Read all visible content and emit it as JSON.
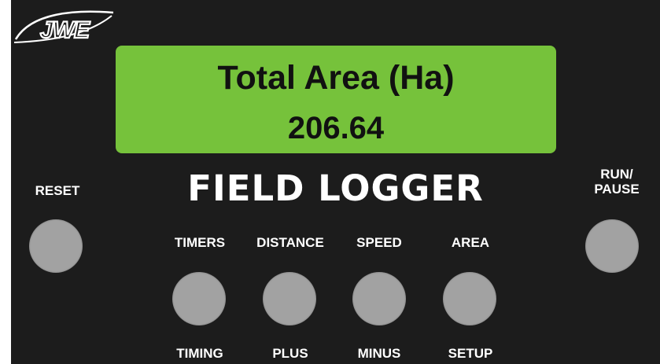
{
  "logo": {
    "text": "JWE"
  },
  "display": {
    "line1": "Total Area (Ha)",
    "line2": "206.64"
  },
  "brand": {
    "title": "FIELD LOGGER"
  },
  "buttons": {
    "reset": {
      "label": "RESET"
    },
    "run_pause": {
      "label_top": "RUN/",
      "label_bottom": "PAUSE"
    },
    "timers": {
      "top_label": "TIMERS",
      "bottom_label": "TIMING"
    },
    "distance": {
      "top_label": "DISTANCE",
      "bottom_label": "PLUS"
    },
    "speed": {
      "top_label": "SPEED",
      "bottom_label": "MINUS"
    },
    "area": {
      "top_label": "AREA",
      "bottom_label": "SETUP"
    }
  },
  "colors": {
    "panel": "#1c1c1c",
    "lcd": "#76c23b",
    "button": "#a2a2a2",
    "text": "#ffffff"
  }
}
